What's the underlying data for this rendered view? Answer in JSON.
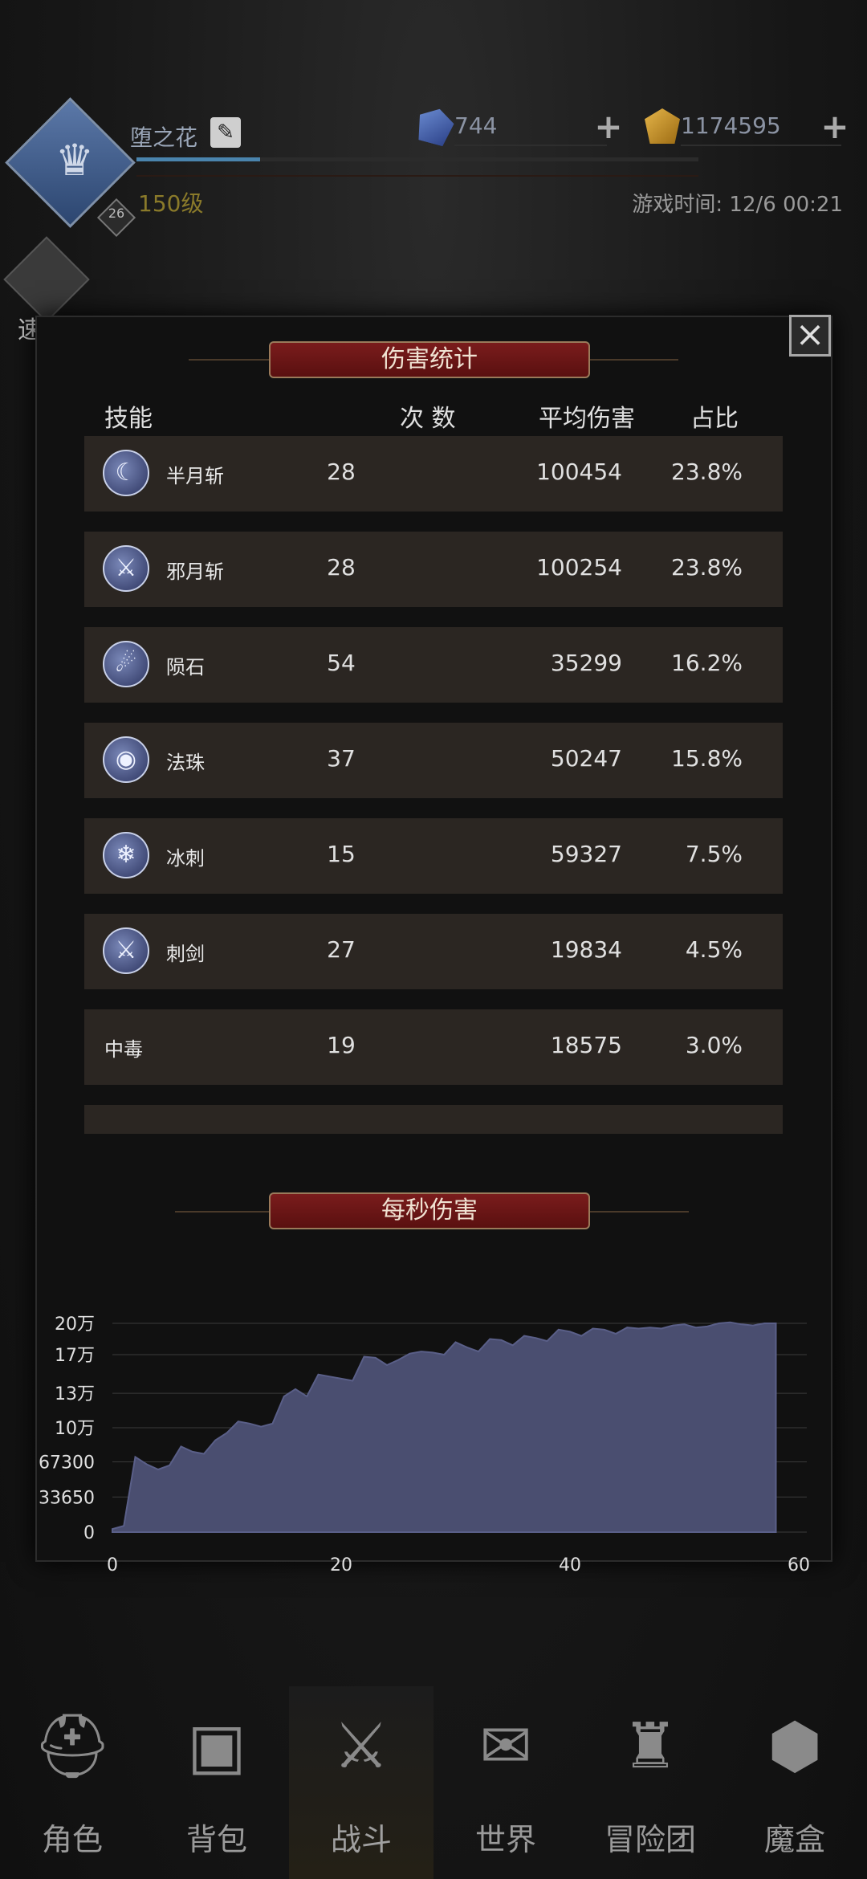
{
  "player": {
    "name": "堕之花",
    "level": "150级",
    "avatar_badge": "26",
    "xp_progress": 0.22,
    "gems": "744",
    "gold": "1174595",
    "game_time": "游戏时间: 12/6 00:21"
  },
  "quick_battle": {
    "label": "速 战"
  },
  "modal": {
    "damage_title": "伤害统计",
    "dps_title": "每秒伤害",
    "headers": {
      "skill": "技能",
      "count": "次 数",
      "avg": "平均伤害",
      "pct": "占比"
    },
    "rows": [
      {
        "icon": "crescent-moon-icon",
        "name": "半月斩",
        "count": "28",
        "avg": "100454",
        "pct": "23.8%"
      },
      {
        "icon": "sword-icon",
        "name": "邪月斩",
        "count": "28",
        "avg": "100254",
        "pct": "23.8%"
      },
      {
        "icon": "meteor-icon",
        "name": "陨石",
        "count": "54",
        "avg": "35299",
        "pct": "16.2%"
      },
      {
        "icon": "orb-icon",
        "name": "法珠",
        "count": "37",
        "avg": "50247",
        "pct": "15.8%"
      },
      {
        "icon": "ice-spike-icon",
        "name": "冰刺",
        "count": "15",
        "avg": "59327",
        "pct": "7.5%"
      },
      {
        "icon": "sword-icon",
        "name": "刺剑",
        "count": "27",
        "avg": "19834",
        "pct": "4.5%"
      },
      {
        "icon": "",
        "name": "中毒",
        "count": "19",
        "avg": "18575",
        "pct": "3.0%"
      }
    ]
  },
  "chart_data": {
    "type": "area",
    "title": "每秒伤害",
    "xlabel": "",
    "ylabel": "",
    "xlim": [
      0,
      60
    ],
    "ylim": [
      0,
      200000
    ],
    "x_ticks": [
      "0",
      "20",
      "40",
      "60"
    ],
    "y_ticks": [
      "0",
      "33650",
      "67300",
      "10万",
      "13万",
      "17万",
      "20万"
    ],
    "y_tick_values": [
      0,
      33650,
      67300,
      100000,
      133000,
      170000,
      200000
    ],
    "grid": true,
    "color": "#4a4e70",
    "x": [
      0,
      1,
      2,
      3,
      4,
      5,
      6,
      7,
      8,
      9,
      10,
      11,
      12,
      13,
      14,
      15,
      16,
      17,
      18,
      19,
      20,
      21,
      22,
      23,
      24,
      25,
      26,
      27,
      28,
      29,
      30,
      31,
      32,
      33,
      34,
      35,
      36,
      37,
      38,
      39,
      40,
      41,
      42,
      43,
      44,
      45,
      46,
      47,
      48,
      49,
      50,
      51,
      52,
      53,
      54,
      55,
      56,
      57,
      58
    ],
    "values": [
      3000,
      6000,
      72000,
      65000,
      60000,
      64000,
      82000,
      77000,
      75000,
      88000,
      95000,
      106000,
      104000,
      101000,
      104000,
      130000,
      137000,
      130000,
      151000,
      149000,
      147000,
      145000,
      168000,
      167000,
      160000,
      165000,
      171000,
      173000,
      172000,
      170000,
      182000,
      177000,
      173000,
      185000,
      184000,
      179000,
      188000,
      186000,
      183000,
      194000,
      192000,
      188000,
      195000,
      194000,
      190000,
      196000,
      195000,
      196000,
      195000,
      198000,
      199000,
      196000,
      197000,
      200000,
      201000,
      199000,
      198000,
      200000,
      200000
    ]
  },
  "nav": [
    {
      "icon": "helmet-icon",
      "label": "角色"
    },
    {
      "icon": "backpack-icon",
      "label": "背包"
    },
    {
      "icon": "shield-sword-icon",
      "label": "战斗"
    },
    {
      "icon": "map-scroll-icon",
      "label": "世界"
    },
    {
      "icon": "castle-icon",
      "label": "冒险团"
    },
    {
      "icon": "magic-box-icon",
      "label": "魔盒"
    }
  ],
  "colors": {
    "banner": "#7a1c1c",
    "row_bg": "#2b2622",
    "area_fill": "#4a4e70"
  }
}
